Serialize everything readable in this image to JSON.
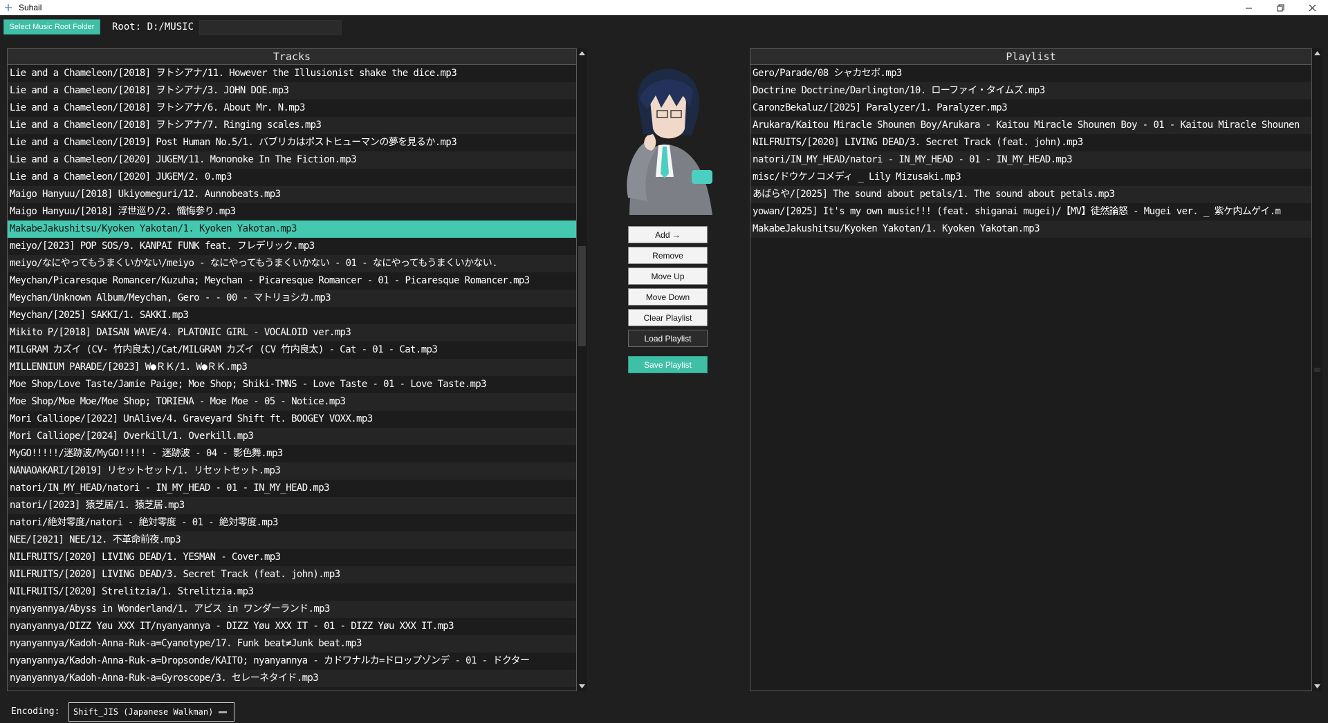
{
  "window": {
    "title": "Suhail",
    "icons": [
      "plus-icon",
      "minimize-icon",
      "restore-icon",
      "close-icon"
    ]
  },
  "topbar": {
    "select_root_label": "Select Music Root Folder",
    "root_text": "Root: D:/MUSIC",
    "root_field_value": ""
  },
  "tracks": {
    "header": "Tracks",
    "selected_index": 9,
    "items": [
      "Lie and a Chameleon/[2018] ヲトシアナ/11. However the Illusionist shake the dice.mp3",
      "Lie and a Chameleon/[2018] ヲトシアナ/3. JOHN DOE.mp3",
      "Lie and a Chameleon/[2018] ヲトシアナ/6. About Mr. N.mp3",
      "Lie and a Chameleon/[2018] ヲトシアナ/7. Ringing scales.mp3",
      "Lie and a Chameleon/[2019] Post Human No.5/1. バブリカはポストヒューマンの夢を見るか.mp3",
      "Lie and a Chameleon/[2020] JUGEM/11. Mononoke In The Fiction.mp3",
      "Lie and a Chameleon/[2020] JUGEM/2. 0.mp3",
      "Maigo Hanyuu/[2018] Ukiyomeguri/12. Aunnobeats.mp3",
      "Maigo Hanyuu/[2018] 浮世巡り/2. 懺悔参り.mp3",
      "MakabeJakushitsu/Kyoken Yakotan/1. Kyoken Yakotan.mp3",
      "meiyo/[2023] POP SOS/9. KANPAI FUNK feat. フレデリック.mp3",
      "meiyo/なにやってもうまくいかない/meiyo - なにやってもうまくいかない - 01 - なにやってもうまくいかない.",
      "Meychan/Picaresque Romancer/Kuzuha; Meychan - Picaresque Romancer - 01 - Picaresque Romancer.mp3",
      "Meychan/Unknown Album/Meychan, Gero -  - 00 - マトリョシカ.mp3",
      "Meychan/[2025] SAKKI/1. SAKKI.mp3",
      "Mikito P/[2018] DAISAN WAVE/4. PLATONIC GIRL - VOCALOID ver.mp3",
      "MILGRAM カズイ (CV- 竹内良太)/Cat/MILGRAM カズイ (CV 竹内良太) - Cat - 01 - Cat.mp3",
      "MILLENNIUM PARADE/[2023] W●ＲＫ/1. W●ＲＫ.mp3",
      "Moe Shop/Love Taste/Jamie Paige; Moe Shop; Shiki-TMNS - Love Taste - 01 - Love Taste.mp3",
      "Moe Shop/Moe Moe/Moe Shop; TORIENA - Moe Moe - 05 - Notice.mp3",
      "Mori Calliope/[2022] UnAlive/4. Graveyard Shift ft. BOOGEY VOXX.mp3",
      "Mori Calliope/[2024] Overkill/1. Overkill.mp3",
      "MyGO!!!!!/迷跡波/MyGO!!!!! - 迷跡波 - 04 - 影色舞.mp3",
      "NANAOAKARI/[2019] リセットセット/1. リセットセット.mp3",
      "natori/IN_MY_HEAD/natori - IN_MY_HEAD - 01 - IN_MY_HEAD.mp3",
      "natori/[2023] 猿芝居/1. 猿芝居.mp3",
      "natori/絶対零度/natori - 絶対零度 - 01 - 絶対零度.mp3",
      "NEE/[2021] NEE/12. 不革命前夜.mp3",
      "NILFRUITS/[2020] LIVING DEAD/1. YESMAN - Cover.mp3",
      "NILFRUITS/[2020] LIVING DEAD/3. Secret Track (feat. john).mp3",
      "NILFRUITS/[2020] Strelitzia/1. Strelitzia.mp3",
      "nyanyannya/Abyss in Wonderland/1. アビス in ワンダーランド.mp3",
      "nyanyannya/DIZZ Yøu XXX IT/nyanyannya - DIZZ Yøu XXX IT - 01 - DIZZ Yøu XXX IT.mp3",
      "nyanyannya/Kadoh-Anna-Ruk-a=Cyanotype/17. Funk beat≠Junk beat.mp3",
      "nyanyannya/Kadoh-Anna-Ruk-a=Dropsonde/KAITO; nyanyannya - カドワナルカ=ドロップゾンデ - 01 - ドクター",
      "nyanyannya/Kadoh-Anna-Ruk-a=Gyroscope/3. セレーネタイド.mp3"
    ]
  },
  "playlist": {
    "header": "Playlist",
    "items": [
      "Gero/Parade/08 シャカセボ.mp3",
      "Doctrine Doctrine/Darlington/10. ローファイ・タイムズ.mp3",
      "CaronzBekaluz/[2025] Paralyzer/1. Paralyzer.mp3",
      "Arukara/Kaitou Miracle Shounen Boy/Arukara - Kaitou Miracle Shounen Boy - 01 - Kaitou Miracle Shounen",
      "NILFRUITS/[2020] LIVING DEAD/3. Secret Track (feat. john).mp3",
      "natori/IN_MY_HEAD/natori - IN_MY_HEAD - 01 - IN_MY_HEAD.mp3",
      "misc/ドウケノコメディ _ Lily Mizusaki.mp3",
      "あばらや/[2025] The sound about petals/1. The sound about petals.mp3",
      "yowan/[2025] It's my own music!!! (feat. shiganai mugei)/【MV】徒然論怒 - Mugei ver. _ 紫ケ内ムゲイ.m",
      "MakabeJakushitsu/Kyoken Yakotan/1. Kyoken Yakotan.mp3"
    ]
  },
  "controls": {
    "add": "Add →",
    "remove": "Remove",
    "move_up": "Move Up",
    "move_down": "Move Down",
    "clear": "Clear Playlist",
    "load": "Load Playlist",
    "save": "Save Playlist",
    "avatar_icon": "anime-character-avatar"
  },
  "encoding": {
    "label": "Encoding:",
    "value": "Shift_JIS (Japanese Walkman)"
  },
  "colors": {
    "accent": "#3fbfa6",
    "selection": "#44c9b0",
    "background": "#1f1f1f"
  }
}
